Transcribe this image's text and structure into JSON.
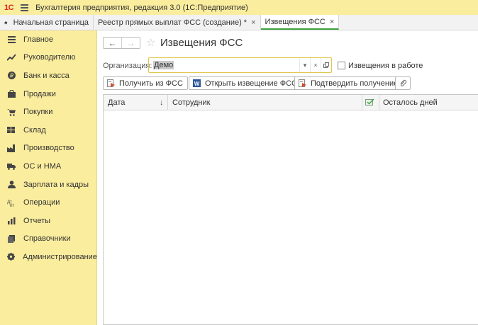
{
  "titlebar": {
    "logo": "1С",
    "title": "Бухгалтерия предприятия, редакция 3.0  (1С:Предприятие)"
  },
  "tabs": [
    {
      "label": "Начальная страница"
    },
    {
      "label": "Реестр прямых выплат ФСС (создание) *",
      "close": "×"
    },
    {
      "label": "Извещения ФСС",
      "close": "×"
    }
  ],
  "sidebar": {
    "items": [
      {
        "label": "Главное",
        "icon": "menu-icon"
      },
      {
        "label": "Руководителю",
        "icon": "chart-trend-icon"
      },
      {
        "label": "Банк и касса",
        "icon": "ruble-icon"
      },
      {
        "label": "Продажи",
        "icon": "shopping-bag-icon"
      },
      {
        "label": "Покупки",
        "icon": "cart-icon"
      },
      {
        "label": "Склад",
        "icon": "warehouse-icon"
      },
      {
        "label": "Производство",
        "icon": "factory-icon"
      },
      {
        "label": "ОС и НМА",
        "icon": "truck-icon"
      },
      {
        "label": "Зарплата и кадры",
        "icon": "person-icon"
      },
      {
        "label": "Операции",
        "icon": "operations-icon"
      },
      {
        "label": "Отчеты",
        "icon": "bar-chart-icon"
      },
      {
        "label": "Справочники",
        "icon": "book-icon"
      },
      {
        "label": "Администрирование",
        "icon": "gear-icon"
      }
    ]
  },
  "main": {
    "title": "Извещения ФСС",
    "org_label": "Организация:",
    "org_value": "Демо",
    "checkbox_label": "Извещения в работе",
    "buttons": {
      "get": "Получить из ФСС",
      "open": "Открыть извещение ФСС",
      "confirm": "Подтвердить получение"
    },
    "table": {
      "columns": [
        "Дата",
        "Сотрудник",
        "Осталось дней"
      ]
    }
  },
  "colors": {
    "panel": "#fbed9e",
    "accent_tab": "#3fa33f",
    "field_border": "#e2c64a"
  }
}
